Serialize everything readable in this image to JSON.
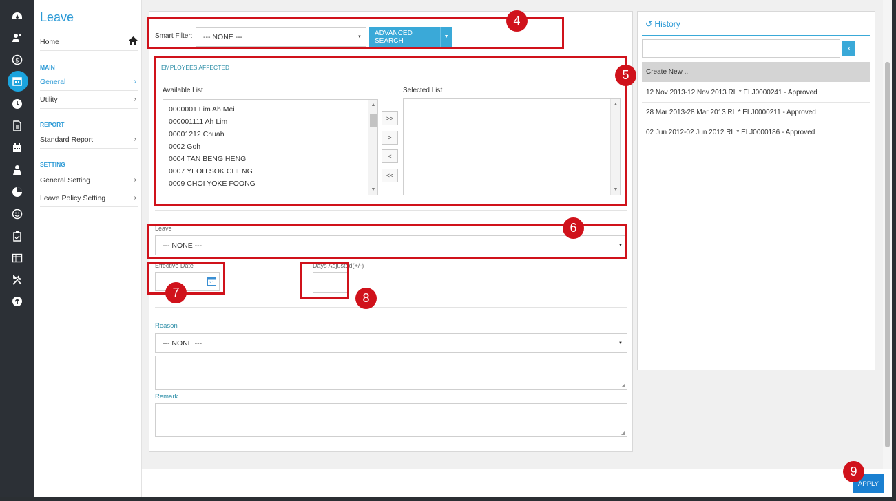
{
  "rail": {
    "icons": [
      "dashboard-icon",
      "users-icon",
      "money-icon",
      "calendar-icon",
      "clock-icon",
      "document-icon",
      "calendar-stack-icon",
      "person-icon",
      "pie-chart-icon",
      "smile-icon",
      "clipboard-icon",
      "table-icon",
      "tools-icon",
      "upload-icon"
    ],
    "active_color": "#1ba3dd"
  },
  "sidebar": {
    "title": "Leave",
    "home": "Home",
    "sections": {
      "main": "MAIN",
      "report": "REPORT",
      "setting": "SETTING"
    },
    "items": {
      "general": "General",
      "utility": "Utility",
      "standard_report": "Standard Report",
      "general_setting": "General Setting",
      "leave_policy_setting": "Leave Policy Setting"
    },
    "chevron": "›"
  },
  "form": {
    "smart_filter_label": "Smart Filter:",
    "smart_filter_value": "--- NONE ---",
    "advanced_search": "ADVANCED SEARCH",
    "employees_affected": "EMPLOYEES AFFECTED",
    "available_list_label": "Available List",
    "selected_list_label": "Selected List",
    "available_list": [
      "0000001 Lim Ah Mei",
      "000001111 Ah Lim",
      "00001212 Chuah",
      "0002 Goh",
      "0004 TAN BENG HENG",
      "0007 YEOH SOK CHENG",
      "0009 CHOI YOKE FOONG"
    ],
    "move_buttons": [
      ">>",
      ">",
      "<",
      "<<"
    ],
    "leave_label": "Leave",
    "leave_value": "--- NONE ---",
    "effective_date_label": "Effective Date",
    "days_adjusted_label": "Days Adjusted(+/-)",
    "reason_label": "Reason",
    "reason_value": "--- NONE ---",
    "remark_label": "Remark"
  },
  "history": {
    "title": "History",
    "clear_button": "x",
    "create_new": "Create New ...",
    "entries": [
      "12 Nov 2013-12 Nov 2013 RL * ELJ0000241 - Approved",
      "28 Mar 2013-28 Mar 2013 RL * ELJ0000211 - Approved",
      "02 Jun 2012-02 Jun 2012 RL * ELJ0000186 - Approved"
    ]
  },
  "apply_button": "APPLY",
  "callouts": [
    "4",
    "5",
    "6",
    "7",
    "8",
    "9"
  ],
  "accent_color": "#3aa9d8",
  "callout_color": "#d0121b"
}
